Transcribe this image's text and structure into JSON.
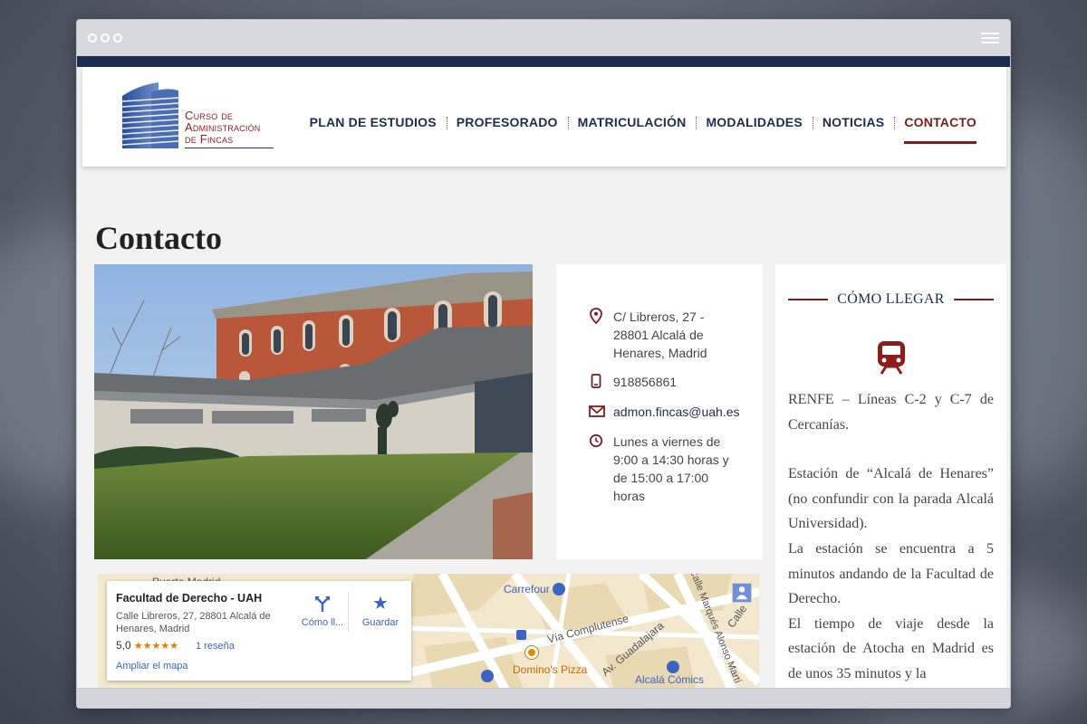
{
  "header": {
    "logo_lines": [
      "Curso de",
      "Administración",
      "de Fincas"
    ],
    "nav": [
      {
        "label": "PLAN DE ESTUDIOS"
      },
      {
        "label": "PROFESORADO"
      },
      {
        "label": "MATRICULACIÓN"
      },
      {
        "label": "MODALIDADES"
      },
      {
        "label": "NOTICIAS"
      },
      {
        "label": "CONTACTO",
        "active": true
      }
    ]
  },
  "page": {
    "title": "Contacto"
  },
  "contact": {
    "address": "C/ Libreros, 27 - 28801 Alcalá de Henares, Madrid",
    "phone": "918856861",
    "email": "admon.fincas@uah.es",
    "hours": "Lunes a viernes de 9:00 a 14:30 horas y de 15:00 a 17:00 horas"
  },
  "sidebar": {
    "title": "CÓMO LLEGAR",
    "p1": "RENFE – Líneas C-2 y C-7 de Cercanías.",
    "p2": "Estación de “Alcalá de Henares” (no confundir con la parada Alcalá Universidad).",
    "p3": "La estación se encuentra a 5 minutos andando de la Facultad de Derecho.",
    "p4": "El tiempo de viaje desde la estación de Atocha en Madrid es de unos 35 minutos y la"
  },
  "map": {
    "place_title": "Facultad de Derecho - UAH",
    "place_address": "Calle Libreros, 27, 28801 Alcalá de Henares, Madrid",
    "rating": "5,0",
    "stars": "★★★★★",
    "reviews": "1 reseña",
    "expand": "Ampliar el mapa",
    "directions": "Cómo ll...",
    "save": "Guardar",
    "labels": {
      "puerta_madrid": "Puerta Madrid",
      "carrefour": "Carrefour",
      "via_complutense": "Vía Complutense",
      "dominos": "Domino's Pizza",
      "alcala_comics": "Alcalá Cómics",
      "av_guadalajara": "Av. Guadalajara",
      "marques": "Calle Marqués Alonso Martí",
      "calle": "Calle"
    }
  },
  "colors": {
    "navy": "#1c2d4f",
    "maroon": "#7c1d1d",
    "logo_blue": "#2f55a4"
  }
}
